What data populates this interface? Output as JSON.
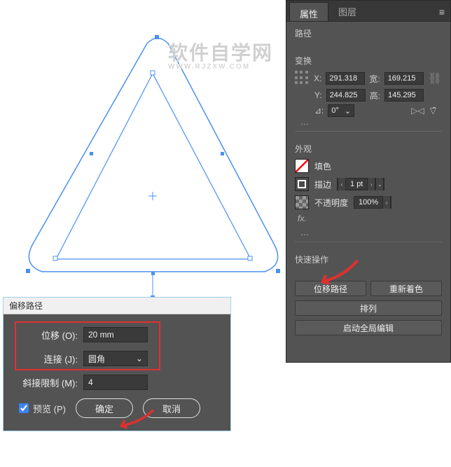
{
  "watermark": {
    "text": "软件自学网",
    "sub": "WWW.RJZXW.COM"
  },
  "panel": {
    "tabs": {
      "properties": "属性",
      "layers": "图层"
    },
    "sections": {
      "path": "路径",
      "transform": "变换",
      "appearance": "外观",
      "quick_actions": "快速操作"
    },
    "transform": {
      "x_label": "X:",
      "x": "291.318",
      "w_label": "宽:",
      "w": "169.215",
      "y_label": "Y:",
      "y": "244.825",
      "h_label": "高:",
      "h": "145.295",
      "angle_label": "⊿:",
      "angle": "0°"
    },
    "appearance": {
      "fill_label": "填色",
      "stroke_label": "描边",
      "stroke_weight": "1 pt",
      "opacity_label": "不透明度",
      "opacity_value": "100%",
      "fx_label": "fx."
    },
    "quick": {
      "offset_path": "位移路径",
      "recolor": "重新着色",
      "arrange": "排列",
      "global_edit": "启动全局编辑"
    }
  },
  "dialog": {
    "title": "偏移路径",
    "offset_label": "位移 (O):",
    "offset_value": "20 mm",
    "join_label": "连接 (J):",
    "join_value": "圆角",
    "miter_label": "斜接限制 (M):",
    "miter_value": "4",
    "preview_label": "预览 (P)",
    "ok_label": "确定",
    "cancel_label": "取消"
  }
}
